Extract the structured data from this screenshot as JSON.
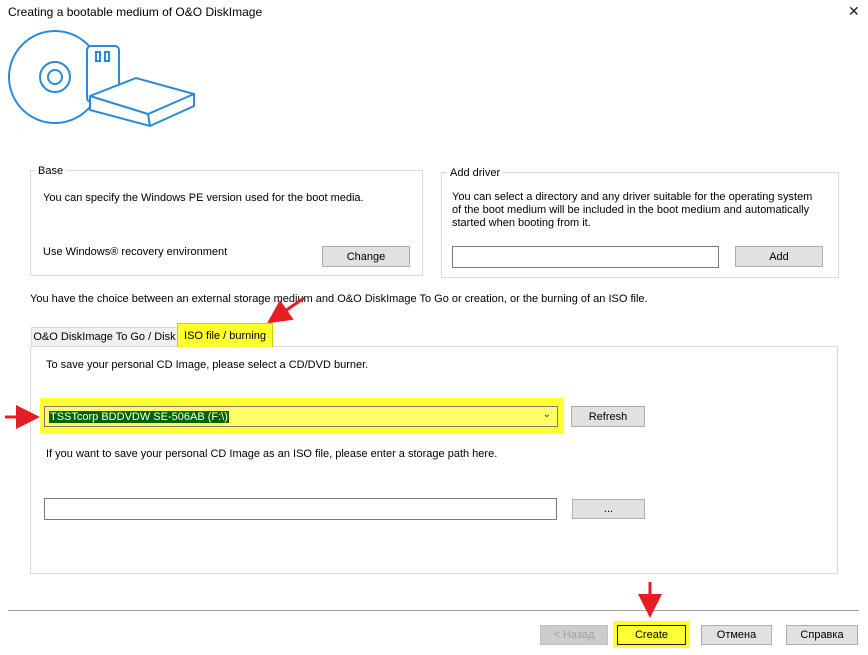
{
  "window": {
    "title": "Creating a bootable medium of O&O DiskImage",
    "close_glyph": "✕"
  },
  "base_group": {
    "label": "Base",
    "description": "You can specify the Windows PE version used for the boot media.",
    "env_text": "Use Windows® recovery environment",
    "change_button": "Change"
  },
  "driver_group": {
    "label": "Add driver",
    "description": "You can select a directory and any driver suitable for the operating system of the boot medium will be included in the boot medium and automatically started when booting from it.",
    "path_value": "",
    "add_button": "Add"
  },
  "choice_text": "You have the choice between an external storage medium and O&O DiskImage To Go or creation, or the burning of an ISO file.",
  "tabs": [
    {
      "label": "O&O DiskImage To Go / Disk",
      "active": false
    },
    {
      "label": "ISO file / burning",
      "active": true
    }
  ],
  "iso_panel": {
    "burner_prompt": "To save your personal CD Image, please select a CD/DVD burner.",
    "burner_selected": "TSSTcorp BDDVDW SE-506AB (F:\\)",
    "refresh_button": "Refresh",
    "iso_prompt": "If you want to save your personal CD Image as an ISO file, please enter a storage path here.",
    "iso_path_value": "",
    "browse_button": "..."
  },
  "footer": {
    "back_button": "< Назад",
    "create_button": "Create",
    "cancel_button": "Отмена",
    "help_button": "Справка"
  },
  "colors": {
    "highlight": "#ffff33",
    "arrow": "#e31e24",
    "selection": "#006400"
  },
  "icons": {
    "logo": "disc-usb-drive-icon",
    "close": "close-icon",
    "dropdown": "chevron-down-icon"
  }
}
